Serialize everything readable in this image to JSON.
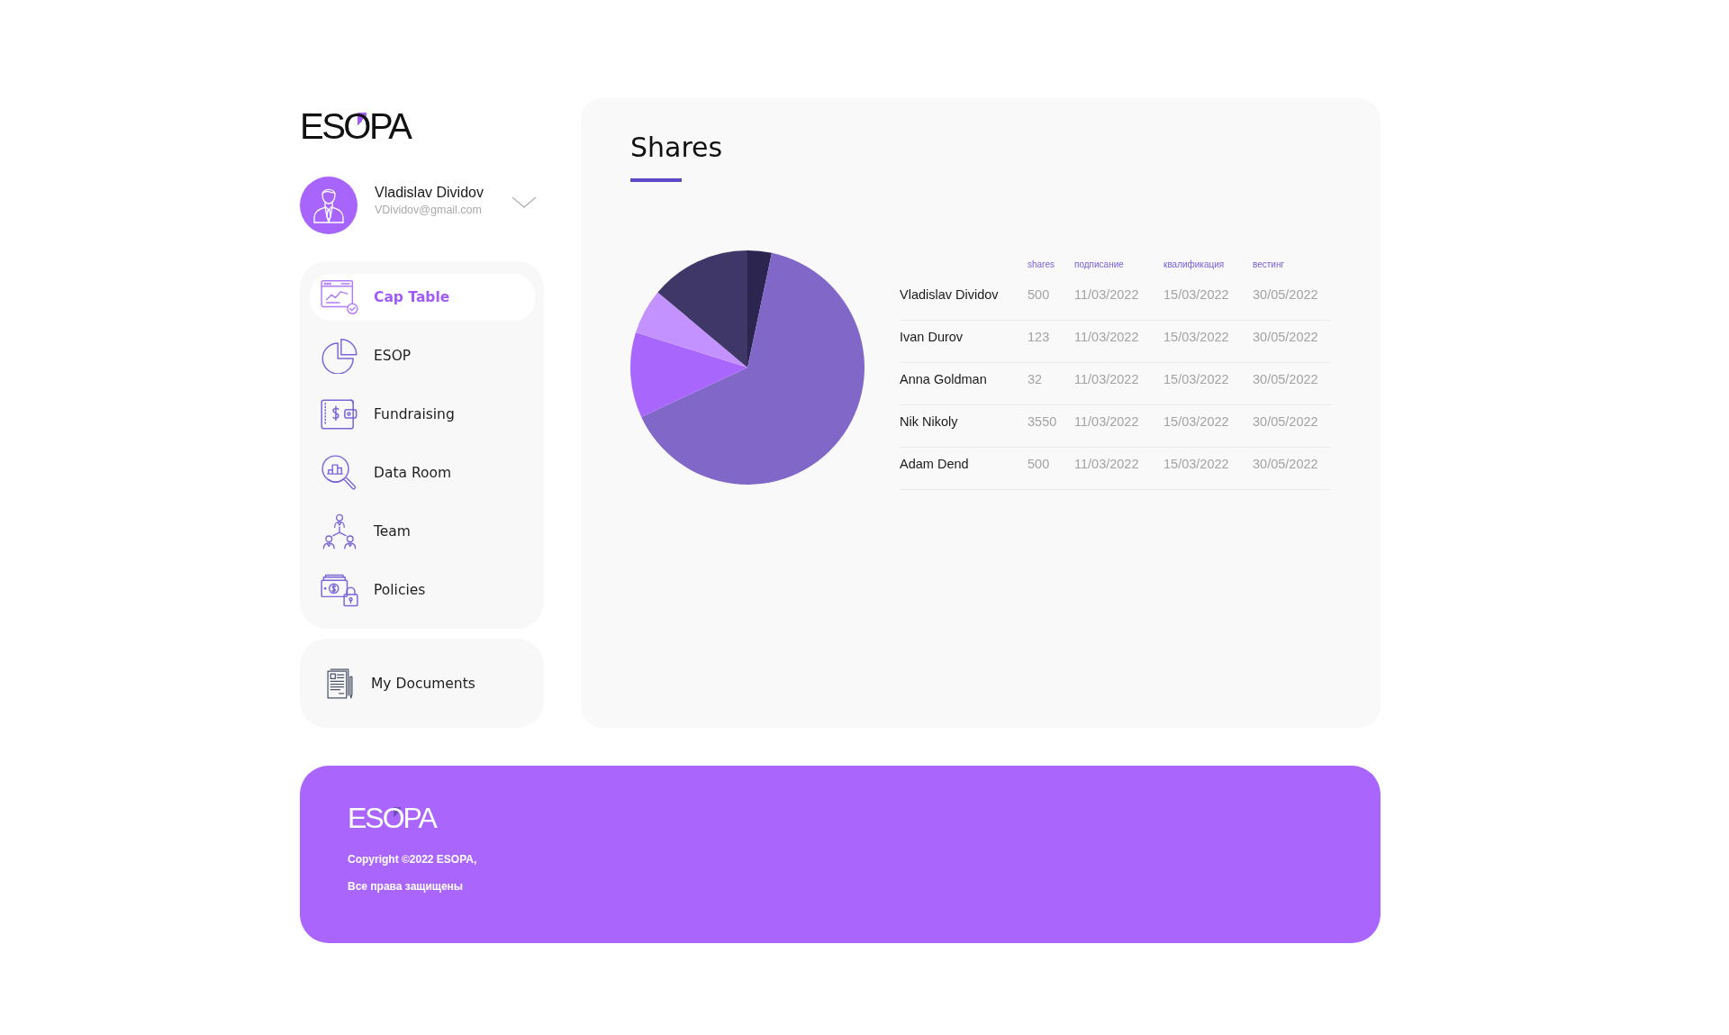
{
  "sidebar": {
    "logo": "ESOPA",
    "user": {
      "name": "Vladislav Dividov",
      "email": "VDividov@gmail.com"
    },
    "nav_items": [
      {
        "label": "Cap Table",
        "selected": true
      },
      {
        "label": "ESOP",
        "selected": false
      },
      {
        "label": "Fundraising",
        "selected": false
      },
      {
        "label": "Data Room",
        "selected": false
      },
      {
        "label": "Team",
        "selected": false
      },
      {
        "label": "Policies",
        "selected": false
      }
    ],
    "documents_link": {
      "label": "My Documents"
    }
  },
  "main": {
    "title": "Shares",
    "table": {
      "columns": [
        "shares",
        "подписание",
        "квалификация",
        "вестинг"
      ],
      "rows": [
        {
          "name": "Vladislav Dividov",
          "cells": [
            "500",
            "11/03/2022",
            "15/03/2022",
            "30/05/2022"
          ]
        },
        {
          "name": "Ivan Durov",
          "cells": [
            "123",
            "11/03/2022",
            "15/03/2022",
            "30/05/2022"
          ]
        },
        {
          "name": "Anna Goldman",
          "cells": [
            "32",
            "11/03/2022",
            "15/03/2022",
            "30/05/2022"
          ]
        },
        {
          "name": "Nik Nikoly",
          "cells": [
            "3550",
            "11/03/2022",
            "15/03/2022",
            "30/05/2022"
          ]
        },
        {
          "name": "Adam Dend",
          "cells": [
            "500",
            "11/03/2022",
            "15/03/2022",
            "30/05/2022"
          ]
        }
      ]
    }
  },
  "footer": {
    "logo": "ESOPA",
    "lines": [
      "Copyright ©2022 ESOPA,",
      "Все права защищены"
    ]
  }
}
